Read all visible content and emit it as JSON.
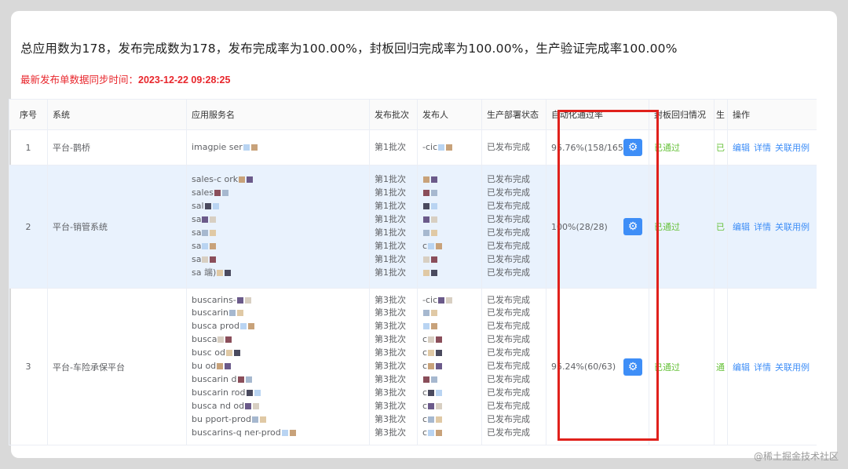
{
  "summary": "总应用数为178，发布完成数为178，发布完成率为100.00%，封板回归完成率为100.00%，生产验证完成率100.00%",
  "sync": {
    "label": "最新发布单数据同步时间：",
    "time": "2023-12-22 09:28:25"
  },
  "table": {
    "headers": {
      "index": "序号",
      "system": "系统",
      "service": "应用服务名",
      "batch": "发布批次",
      "publisher": "发布人",
      "deploy": "生产部署状态",
      "auto_rate": "自动化通过率",
      "regression": "封板回归情况",
      "prod_verify": "生",
      "ops": "操作"
    },
    "rows": [
      {
        "index": "1",
        "system": "平台-鹊桥",
        "services": [
          "imagpie          ser"
        ],
        "batches": [
          "第1批次"
        ],
        "publishers": [
          "     -cic"
        ],
        "deploy": [
          "已发布完成"
        ],
        "auto_rate": "95.76%(158/165)",
        "regression": "已通过",
        "prod_verify": "已",
        "ops": [
          "编辑",
          "详情",
          "关联用例"
        ]
      },
      {
        "index": "2",
        "system": "平台-销管系统",
        "services": [
          "sales-c      ork",
          "sales",
          "sal",
          "sa",
          "sa",
          "sa",
          "sa",
          "sa    端)"
        ],
        "batches": [
          "第1批次",
          "第1批次",
          "第1批次",
          "第1批次",
          "第1批次",
          "第1批次",
          "第1批次",
          "第1批次"
        ],
        "publishers": [
          "",
          "",
          "",
          "",
          "",
          "c",
          "",
          ""
        ],
        "deploy": [
          "已发布完成",
          "已发布完成",
          "已发布完成",
          "已发布完成",
          "已发布完成",
          "已发布完成",
          "已发布完成",
          "已发布完成"
        ],
        "auto_rate": "100%(28/28)",
        "regression": "已通过",
        "prod_verify": "已",
        "ops": [
          "编辑",
          "详情",
          "关联用例"
        ]
      },
      {
        "index": "3",
        "system": "平台-车险承保平台",
        "services": [
          "buscarins-",
          "buscarin",
          "busca          prod",
          "busca",
          "busc              od",
          "bu               od",
          "buscarin        d",
          "buscarin        rod",
          "busca    nd      od",
          "bu          pport-prod",
          "buscarins-q        ner-prod"
        ],
        "batches": [
          "第3批次",
          "第3批次",
          "第3批次",
          "第3批次",
          "第3批次",
          "第3批次",
          "第3批次",
          "第3批次",
          "第3批次",
          "第3批次",
          "第3批次"
        ],
        "publishers": [
          "  -cic",
          "",
          "",
          "c",
          "c",
          "c",
          "",
          "c",
          "c",
          "c",
          "c"
        ],
        "deploy": [
          "已发布完成",
          "已发布完成",
          "已发布完成",
          "已发布完成",
          "已发布完成",
          "已发布完成",
          "已发布完成",
          "已发布完成",
          "已发布完成",
          "已发布完成",
          "已发布完成"
        ],
        "auto_rate": "95.24%(60/63)",
        "regression": "已通过",
        "prod_verify": "通",
        "ops": [
          "编辑",
          "详情",
          "关联用例"
        ]
      }
    ]
  },
  "icons": {
    "gear": "gear-icon"
  },
  "colors": {
    "accent": "#3e8ef7",
    "danger": "#e8262c",
    "success": "#67c23a",
    "selected_row": "#e9f2fd"
  },
  "watermark": "@稀土掘金技术社区"
}
